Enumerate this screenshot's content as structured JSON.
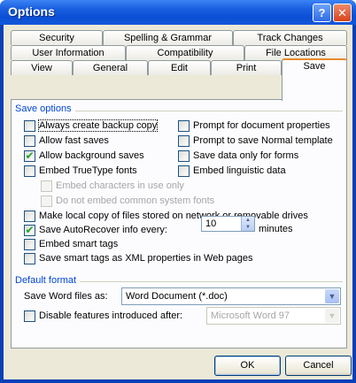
{
  "window": {
    "title": "Options",
    "help_glyph": "?",
    "close_glyph": "✕"
  },
  "tabs": {
    "row1": [
      "Security",
      "Spelling & Grammar",
      "Track Changes"
    ],
    "row2": [
      "User Information",
      "Compatibility",
      "File Locations"
    ],
    "row3": [
      "View",
      "General",
      "Edit",
      "Print",
      "Save"
    ],
    "active": "Save"
  },
  "save_options": {
    "group_label": "Save options",
    "left_column": [
      {
        "label": "Always create backup copy",
        "checked": false
      },
      {
        "label": "Allow fast saves",
        "checked": false
      },
      {
        "label": "Allow background saves",
        "checked": true
      },
      {
        "label": "Embed TrueType fonts",
        "checked": false
      }
    ],
    "right_column": [
      {
        "label": "Prompt for document properties",
        "checked": false
      },
      {
        "label": "Prompt to save Normal template",
        "checked": false
      },
      {
        "label": "Save data only for forms",
        "checked": false
      },
      {
        "label": "Embed linguistic data",
        "checked": false
      }
    ],
    "sub_options": [
      {
        "label": "Embed characters in use only",
        "checked": false,
        "disabled": true
      },
      {
        "label": "Do not embed common system fonts",
        "checked": false,
        "disabled": true
      }
    ],
    "make_local_copy": {
      "label": "Make local copy of files stored on network or removable drives",
      "checked": false
    },
    "autorecover": {
      "label": "Save AutoRecover info every:",
      "checked": true,
      "value": "10",
      "unit": "minutes"
    },
    "embed_smart_tags": {
      "label": "Embed smart tags",
      "checked": false
    },
    "save_smart_tags_xml": {
      "label": "Save smart tags as XML properties in Web pages",
      "checked": false
    }
  },
  "default_format": {
    "group_label": "Default format",
    "save_word_files_label": "Save Word files as:",
    "save_word_files_value": "Word Document (*.doc)",
    "disable_features": {
      "label": "Disable features introduced after:",
      "checked": false
    },
    "disable_features_value": "Microsoft Word 97"
  },
  "buttons": {
    "ok": "OK",
    "cancel": "Cancel"
  }
}
